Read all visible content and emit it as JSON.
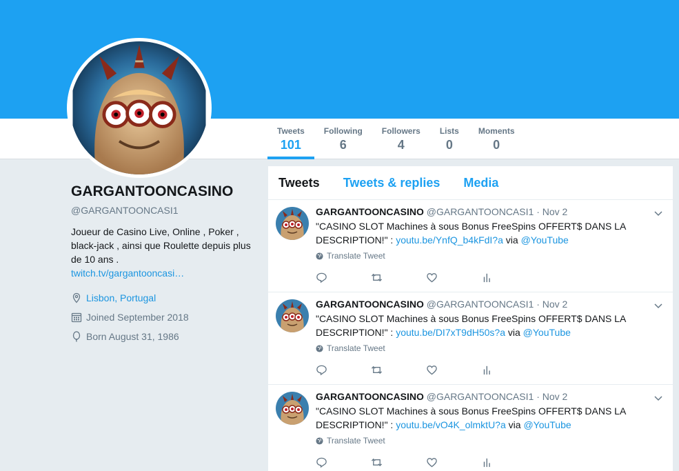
{
  "profile": {
    "name": "GARGANTOONCASINO",
    "handle": "@GARGANTOONCASI1",
    "bio": "Joueur de Casino Live, Online , Poker , black-jack , ainsi que Roulette depuis plus de 10 ans .",
    "bio_link": "twitch.tv/gargantooncasi…",
    "location": "Lisbon, Portugal",
    "joined": "Joined September 2018",
    "born": "Born August 31, 1986",
    "icons": {
      "location": "location-pin-icon",
      "joined": "calendar-icon",
      "born": "balloon-icon"
    }
  },
  "stats": [
    {
      "label": "Tweets",
      "value": "101"
    },
    {
      "label": "Following",
      "value": "6"
    },
    {
      "label": "Followers",
      "value": "4"
    },
    {
      "label": "Lists",
      "value": "0"
    },
    {
      "label": "Moments",
      "value": "0"
    }
  ],
  "timeline": {
    "tabs": [
      "Tweets",
      "Tweets & replies",
      "Media"
    ],
    "tweets": [
      {
        "name": "GARGANTOONCASINO",
        "handle": "@GARGANTOONCASI1",
        "sep": "·",
        "date": "Nov 2",
        "text": "\"CASINO SLOT Machines à sous Bonus FreeSpins OFFERT$ DANS LA DESCRIPTION!\" : ",
        "link": "youtu.be/YnfQ_b4kFdI?a",
        "via": " via ",
        "mention": "@YouTube",
        "translate": "Translate Tweet"
      },
      {
        "name": "GARGANTOONCASINO",
        "handle": "@GARGANTOONCASI1",
        "sep": "·",
        "date": "Nov 2",
        "text": "\"CASINO SLOT Machines à sous Bonus FreeSpins OFFERT$ DANS LA DESCRIPTION!\" : ",
        "link": "youtu.be/DI7xT9dH50s?a",
        "via": " via ",
        "mention": "@YouTube",
        "translate": "Translate Tweet"
      },
      {
        "name": "GARGANTOONCASINO",
        "handle": "@GARGANTOONCASI1",
        "sep": "·",
        "date": "Nov 2",
        "text": "\"CASINO SLOT Machines à sous Bonus FreeSpins OFFERT$ DANS LA DESCRIPTION!\" : ",
        "link": "youtu.be/vO4K_olmktU?a",
        "via": " via ",
        "mention": "@YouTube",
        "translate": "Translate Tweet"
      }
    ]
  },
  "colors": {
    "accent": "#1da1f2",
    "link": "#1b95e0",
    "muted": "#657786",
    "background": "#e6ecf0"
  }
}
